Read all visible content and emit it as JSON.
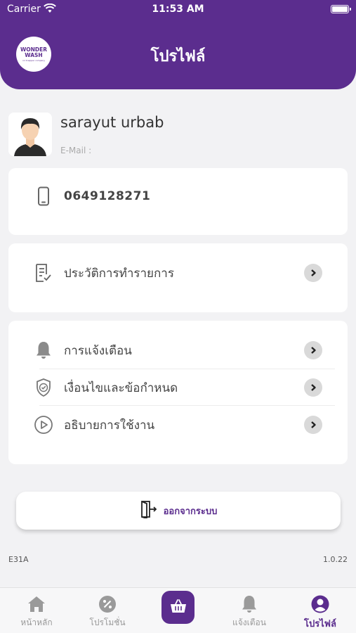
{
  "status_bar": {
    "carrier": "Carrier",
    "time": "11:53 AM"
  },
  "header": {
    "title": "โปรไฟล์",
    "logo_line1": "WONDER",
    "logo_line2": "WASH",
    "logo_sub": "on Snapper company"
  },
  "profile": {
    "name": "sarayut urbab",
    "email_label": "E-Mail :"
  },
  "contact": {
    "phone": "0649128271"
  },
  "menu": {
    "history": "ประวัติการทำรายการ",
    "notifications": "การแจ้งเตือน",
    "terms": "เงื่อนไขและข้อกำหนด",
    "guide": "อธิบายการใช้งาน"
  },
  "logout_label": "ออกจากระบบ",
  "footer": {
    "code": "E31A",
    "version": "1.0.22"
  },
  "tabs": {
    "home": "หน้าหลัก",
    "promotion": "โปรโมชั่น",
    "notification": "แจ้งเตือน",
    "profile": "โปรไฟล์"
  },
  "colors": {
    "brand": "#5b2d8e",
    "background": "#f2f2f4",
    "chevron_bg": "#d9d9d9"
  }
}
